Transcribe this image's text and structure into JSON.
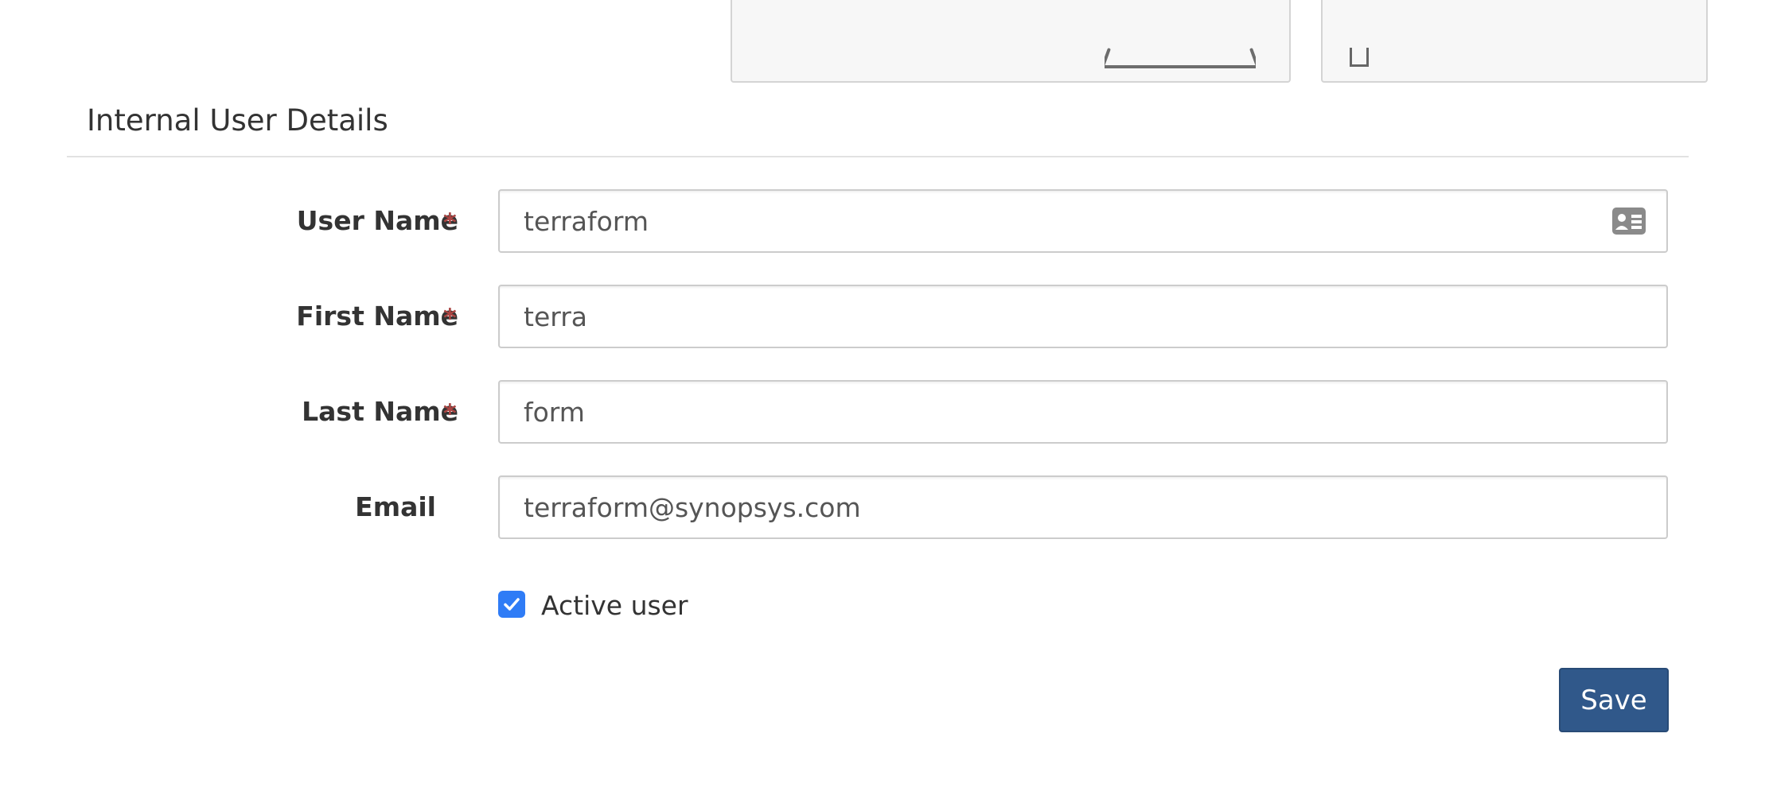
{
  "section": {
    "title": "Internal User Details"
  },
  "form": {
    "required_marker": "*",
    "user_name": {
      "label": "User Name",
      "value": "terraform"
    },
    "first_name": {
      "label": "First Name",
      "value": "terra"
    },
    "last_name": {
      "label": "Last Name",
      "value": "form"
    },
    "email": {
      "label": "Email",
      "value": "terraform@synopsys.com"
    },
    "active": {
      "label": "Active user",
      "checked": true
    },
    "save_label": "Save"
  },
  "colors": {
    "primary_button": "#30588a",
    "checkbox": "#2f7cf6",
    "required": "#a94442"
  },
  "icons": {
    "user_name_field": "id-card-icon",
    "active_checkbox": "checkmark-icon"
  }
}
